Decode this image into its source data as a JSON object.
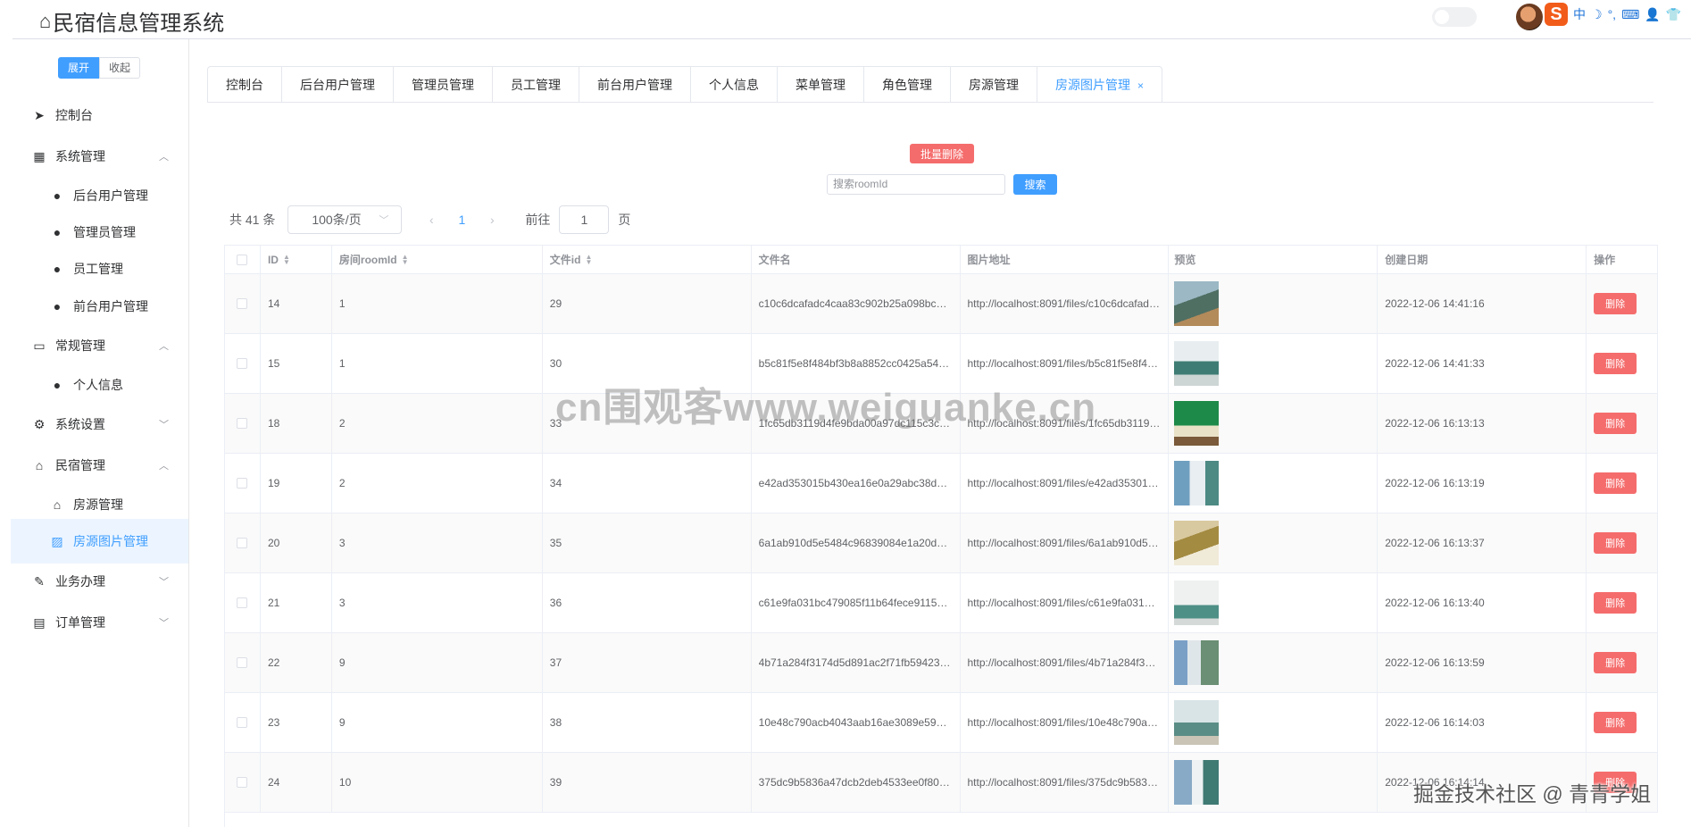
{
  "header": {
    "title": "民宿信息管理系统",
    "ime": [
      "中",
      "☽",
      "°,",
      "⌨",
      "👤",
      "👕"
    ]
  },
  "sidebar": {
    "expand_label": "展开",
    "fold_label": "收起",
    "items": [
      {
        "label": "控制台",
        "icon": "send-icon",
        "glyph": "➤",
        "arrow": ""
      },
      {
        "label": "系统管理",
        "icon": "grid-icon",
        "glyph": "▦",
        "arrow": "︿"
      },
      {
        "label": "后台用户管理",
        "icon": "user-icon",
        "glyph": "●",
        "arrow": ""
      },
      {
        "label": "管理员管理",
        "icon": "user-icon",
        "glyph": "●",
        "arrow": ""
      },
      {
        "label": "员工管理",
        "icon": "user-icon",
        "glyph": "●",
        "arrow": ""
      },
      {
        "label": "前台用户管理",
        "icon": "user-icon",
        "glyph": "●",
        "arrow": ""
      },
      {
        "label": "常规管理",
        "icon": "card-icon",
        "glyph": "▭",
        "arrow": "︿"
      },
      {
        "label": "个人信息",
        "icon": "user-icon",
        "glyph": "●",
        "arrow": ""
      },
      {
        "label": "系统设置",
        "icon": "gear-icon",
        "glyph": "⚙",
        "arrow": "﹀"
      },
      {
        "label": "民宿管理",
        "icon": "home-icon",
        "glyph": "⌂",
        "arrow": "︿"
      },
      {
        "label": "房源管理",
        "icon": "home-icon",
        "glyph": "⌂",
        "arrow": ""
      },
      {
        "label": "房源图片管理",
        "icon": "picture-icon",
        "glyph": "▨",
        "arrow": ""
      },
      {
        "label": "业务办理",
        "icon": "edit-icon",
        "glyph": "✎",
        "arrow": "﹀"
      },
      {
        "label": "订单管理",
        "icon": "clipboard-icon",
        "glyph": "▤",
        "arrow": "﹀"
      }
    ]
  },
  "tabs": [
    "控制台",
    "后台用户管理",
    "管理员管理",
    "员工管理",
    "前台用户管理",
    "个人信息",
    "菜单管理",
    "角色管理",
    "房源管理",
    "房源图片管理"
  ],
  "toolbar": {
    "batch_delete": "批量删除",
    "search_placeholder": "搜索roomId",
    "search_button": "搜索"
  },
  "pagination": {
    "total": "共 41 条",
    "page_size": "100条/页",
    "current_page": "1",
    "goto_label": "前往",
    "goto_value": "1",
    "page_suffix": "页"
  },
  "table": {
    "columns": [
      "ID",
      "房间roomId",
      "文件id",
      "文件名",
      "图片地址",
      "预览",
      "创建日期",
      "操作"
    ],
    "delete_label": "删除",
    "rows": [
      {
        "id": "14",
        "roomId": "1",
        "fileId": "29",
        "fileName": "c10c6dcafadc4caa83c902b25a098bc…",
        "url": "http://localhost:8091/files/c10c6dcafad…",
        "date": "2022-12-06 14:41:16",
        "thumb": "thumb-1"
      },
      {
        "id": "15",
        "roomId": "1",
        "fileId": "30",
        "fileName": "b5c81f5e8f484bf3b8a8852cc0425a54…",
        "url": "http://localhost:8091/files/b5c81f5e8f4…",
        "date": "2022-12-06 14:41:33",
        "thumb": "thumb-2"
      },
      {
        "id": "18",
        "roomId": "2",
        "fileId": "33",
        "fileName": "1fc65db3119d4fe9bda00a97dc115c3c…",
        "url": "http://localhost:8091/files/1fc65db3119…",
        "date": "2022-12-06 16:13:13",
        "thumb": "thumb-3"
      },
      {
        "id": "19",
        "roomId": "2",
        "fileId": "34",
        "fileName": "e42ad353015b430ea16e0a29abc38d…",
        "url": "http://localhost:8091/files/e42ad35301…",
        "date": "2022-12-06 16:13:19",
        "thumb": "thumb-4"
      },
      {
        "id": "20",
        "roomId": "3",
        "fileId": "35",
        "fileName": "6a1ab910d5e5484c96839084e1a20d…",
        "url": "http://localhost:8091/files/6a1ab910d5…",
        "date": "2022-12-06 16:13:37",
        "thumb": "thumb-5"
      },
      {
        "id": "21",
        "roomId": "3",
        "fileId": "36",
        "fileName": "c61e9fa031bc479085f11b64fece9115…",
        "url": "http://localhost:8091/files/c61e9fa031…",
        "date": "2022-12-06 16:13:40",
        "thumb": "thumb-6"
      },
      {
        "id": "22",
        "roomId": "9",
        "fileId": "37",
        "fileName": "4b71a284f3174d5d891ac2f71fb59423…",
        "url": "http://localhost:8091/files/4b71a284f3…",
        "date": "2022-12-06 16:13:59",
        "thumb": "thumb-7"
      },
      {
        "id": "23",
        "roomId": "9",
        "fileId": "38",
        "fileName": "10e48c790acb4043aab16ae3089e59…",
        "url": "http://localhost:8091/files/10e48c790a…",
        "date": "2022-12-06 16:14:03",
        "thumb": "thumb-8"
      },
      {
        "id": "24",
        "roomId": "10",
        "fileId": "39",
        "fileName": "375dc9b5836a47dcb2deb4533ee0f80…",
        "url": "http://localhost:8091/files/375dc9b583…",
        "date": "2022-12-06 16:14:14",
        "thumb": "thumb-9"
      }
    ]
  },
  "watermarks": {
    "center": "cn围观客www.weiguanke.cn",
    "footer": "掘金技术社区 @ 青青学姐"
  },
  "colors": {
    "primary": "#409eff",
    "danger": "#f56c6c",
    "active_bg": "#ecf5ff"
  }
}
